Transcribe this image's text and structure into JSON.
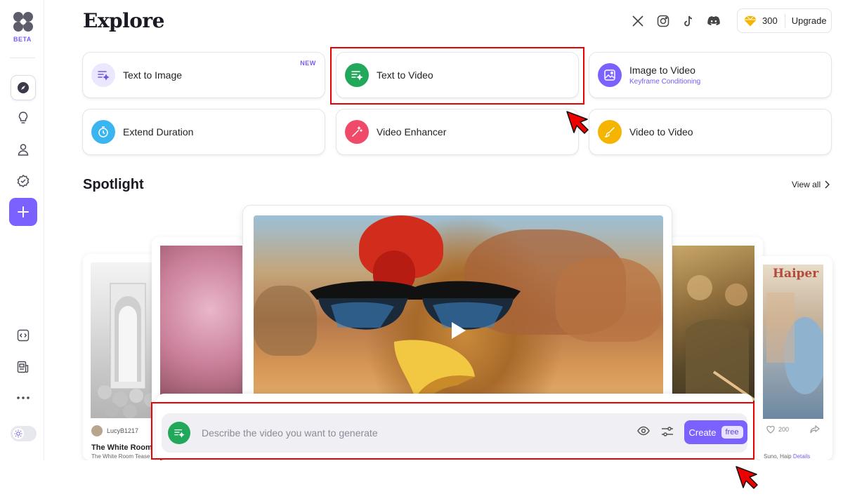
{
  "sidebar": {
    "beta_label": "BETA",
    "items": [
      {
        "name": "explore",
        "icon": "compass-icon"
      },
      {
        "name": "ideas",
        "icon": "lightbulb-icon"
      },
      {
        "name": "profile",
        "icon": "user-icon"
      },
      {
        "name": "verified",
        "icon": "badge-check-icon"
      },
      {
        "name": "create",
        "icon": "plus-icon"
      }
    ],
    "bottom_items": [
      {
        "name": "api",
        "icon": "code-icon"
      },
      {
        "name": "blog",
        "icon": "newspaper-icon"
      },
      {
        "name": "more",
        "icon": "more-dots-icon"
      }
    ],
    "theme_toggle": "light"
  },
  "header": {
    "title": "Explore",
    "socials": [
      "x-icon",
      "instagram-icon",
      "tiktok-icon",
      "discord-icon"
    ],
    "credits": "300",
    "upgrade_label": "Upgrade"
  },
  "tools": [
    {
      "label": "Text to Image",
      "badge": "NEW",
      "icon": "text-sparkle-icon",
      "color": "#ebe7ff"
    },
    {
      "label": "Text to Video",
      "icon": "text-sparkle-icon",
      "color": "#22a85a"
    },
    {
      "label": "Image to Video",
      "sub": "Keyframe Conditioning",
      "icon": "image-icon",
      "color": "#7b61ff"
    },
    {
      "label": "Extend Duration",
      "icon": "timer-icon",
      "color": "#3bb5f0"
    },
    {
      "label": "Video Enhancer",
      "icon": "wand-icon",
      "color": "#f04a6a"
    },
    {
      "label": "Video to Video",
      "icon": "brush-icon",
      "color": "#f5b400"
    }
  ],
  "spotlight": {
    "title": "Spotlight",
    "view_all": "View all",
    "left_card": {
      "user": "LucyB1217",
      "title": "The White Room",
      "subtitle": "The White Room Tease"
    },
    "right_card": {
      "likes": "200",
      "subtitle": "Suno, Haip",
      "link": "Details",
      "watermark": "Haiper"
    }
  },
  "prompt": {
    "placeholder": "Describe the video you want to generate",
    "create_label": "Create",
    "free_label": "free"
  }
}
